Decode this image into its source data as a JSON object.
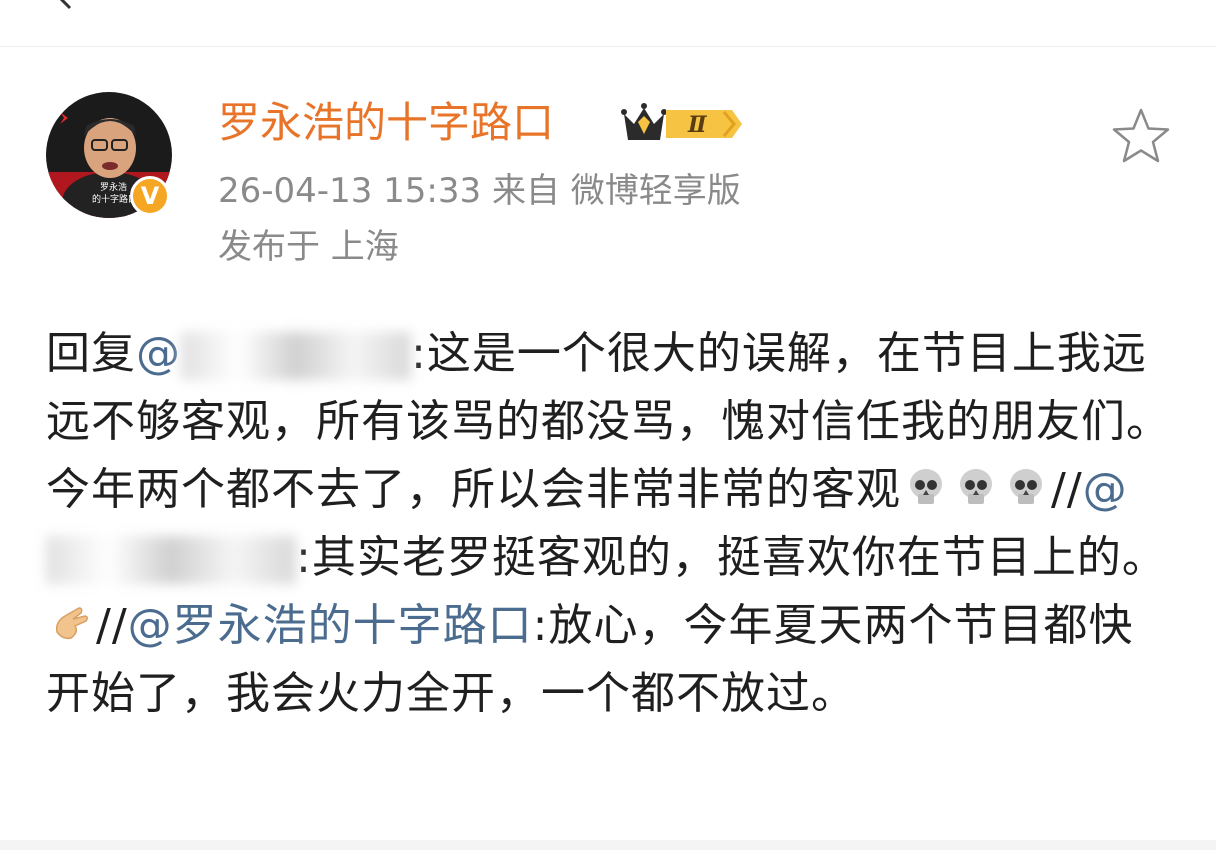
{
  "post": {
    "username": "罗永浩的十字路口",
    "vip_level": "Ⅱ",
    "verified_badge": "V",
    "timestamp": "26-04-13 15:33",
    "source": "来自 微博轻享版",
    "location": "发布于 上海",
    "avatar_caption_line1": "罗永浩",
    "avatar_caption_line2": "的十字路口"
  },
  "content": {
    "seg1": "回复",
    "mention1": "@",
    "seg2": ":这是一个很大的误解，在节目上我远远不够客观，所有该骂的都没骂，愧对信任我的朋友们。今年两个都不去了，所以会非常非常的客观",
    "seg3": "//",
    "mention2": "@",
    "seg4": ":其实老罗挺客观的，挺喜欢你在节目上的。",
    "seg5": "//",
    "mention3": "@罗永浩的十字路口",
    "seg6": ":放心，今年夏天两个节目都快开始了，我会火力全开，一个都不放过。"
  },
  "icons": {
    "back": "back-arrow-icon",
    "favorite": "star-outline-icon",
    "skull": "skull-emoji-icon",
    "pinch": "pinching-hand-emoji-icon",
    "crown": "vip-crown-icon"
  },
  "colors": {
    "username": "#e8742a",
    "meta": "#8a8a8a",
    "mention": "#4b6c8f",
    "badge": "#f5a623",
    "text": "#1f1f1f"
  }
}
